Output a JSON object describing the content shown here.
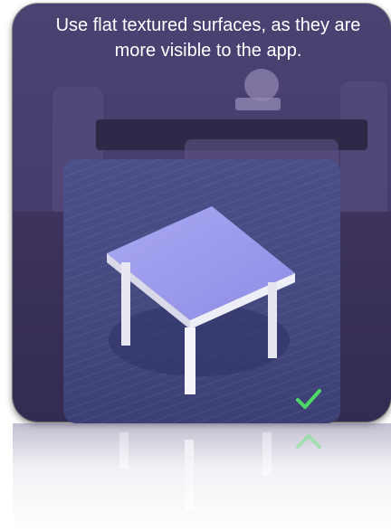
{
  "hint": {
    "text": "Use flat textured surfaces, as they are more visible to the app."
  },
  "illustration": {
    "subject": "table-on-wood-floor",
    "accent": "#4cd964"
  },
  "confirm": {
    "icon": "checkmark-icon",
    "color": "#4cd964"
  }
}
